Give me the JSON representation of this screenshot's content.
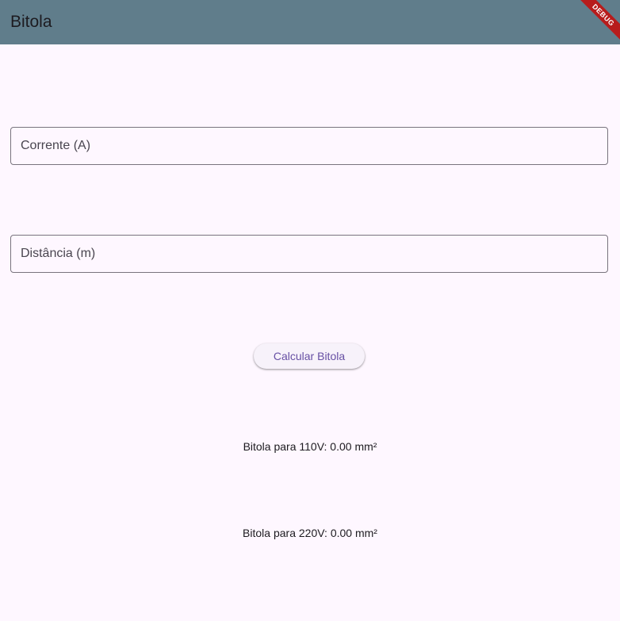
{
  "app_bar": {
    "title": "Bitola",
    "debug_label": "DEBUG"
  },
  "form": {
    "current_field": {
      "label": "Corrente (A)",
      "value": ""
    },
    "distance_field": {
      "label": "Distância (m)",
      "value": ""
    },
    "calculate_button_label": "Calcular Bitola"
  },
  "results": {
    "gauge_110v": "Bitola para 110V: 0.00 mm²",
    "gauge_220v": "Bitola para 220V: 0.00 mm²"
  },
  "colors": {
    "app_bar": "#607d8b",
    "background": "#fef7ff",
    "button_text": "#6750a4",
    "debug_banner": "#b71c1c"
  }
}
